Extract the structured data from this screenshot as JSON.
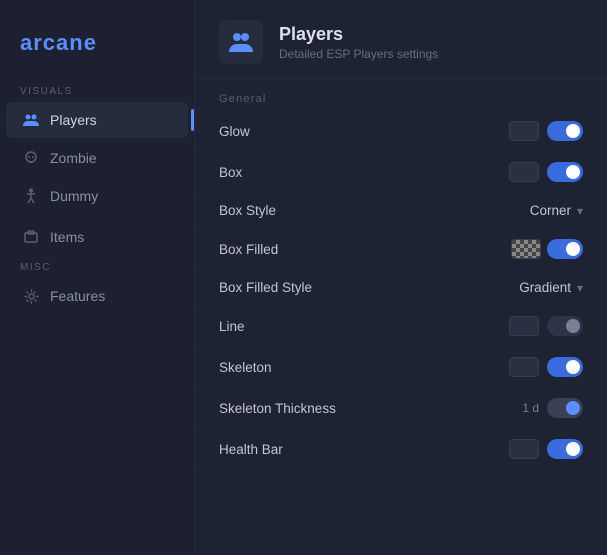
{
  "app": {
    "logo": "arcane"
  },
  "sidebar": {
    "sections": [
      {
        "label": "VISUALS",
        "items": [
          {
            "id": "players",
            "label": "Players",
            "icon": "players",
            "active": true
          },
          {
            "id": "zombie",
            "label": "Zombie",
            "icon": "skull",
            "active": false
          },
          {
            "id": "dummy",
            "label": "Dummy",
            "icon": "dummy",
            "active": false
          }
        ]
      },
      {
        "label": "",
        "items": [
          {
            "id": "items",
            "label": "Items",
            "icon": "items",
            "active": false
          }
        ]
      },
      {
        "label": "MISC",
        "items": [
          {
            "id": "features",
            "label": "Features",
            "icon": "gear",
            "active": false
          }
        ]
      }
    ]
  },
  "page": {
    "title": "Players",
    "subtitle": "Detailed ESP Players settings",
    "section_general": "General"
  },
  "settings": [
    {
      "id": "glow",
      "label": "Glow",
      "type": "toggle-with-btn",
      "state": "on"
    },
    {
      "id": "box",
      "label": "Box",
      "type": "toggle-with-btn",
      "state": "on"
    },
    {
      "id": "box-style",
      "label": "Box Style",
      "type": "dropdown",
      "value": "Corner"
    },
    {
      "id": "box-filled",
      "label": "Box Filled",
      "type": "checker-toggle",
      "state": "on"
    },
    {
      "id": "box-filled-style",
      "label": "Box Filled Style",
      "type": "dropdown",
      "value": "Gradient"
    },
    {
      "id": "line",
      "label": "Line",
      "type": "toggle-with-btn-gray",
      "state": "off"
    },
    {
      "id": "skeleton",
      "label": "Skeleton",
      "type": "toggle-with-btn",
      "state": "on"
    },
    {
      "id": "skeleton-thickness",
      "label": "Skeleton Thickness",
      "type": "thickness",
      "value": "1 d"
    },
    {
      "id": "health-bar",
      "label": "Health Bar",
      "type": "toggle-with-btn",
      "state": "on"
    }
  ]
}
